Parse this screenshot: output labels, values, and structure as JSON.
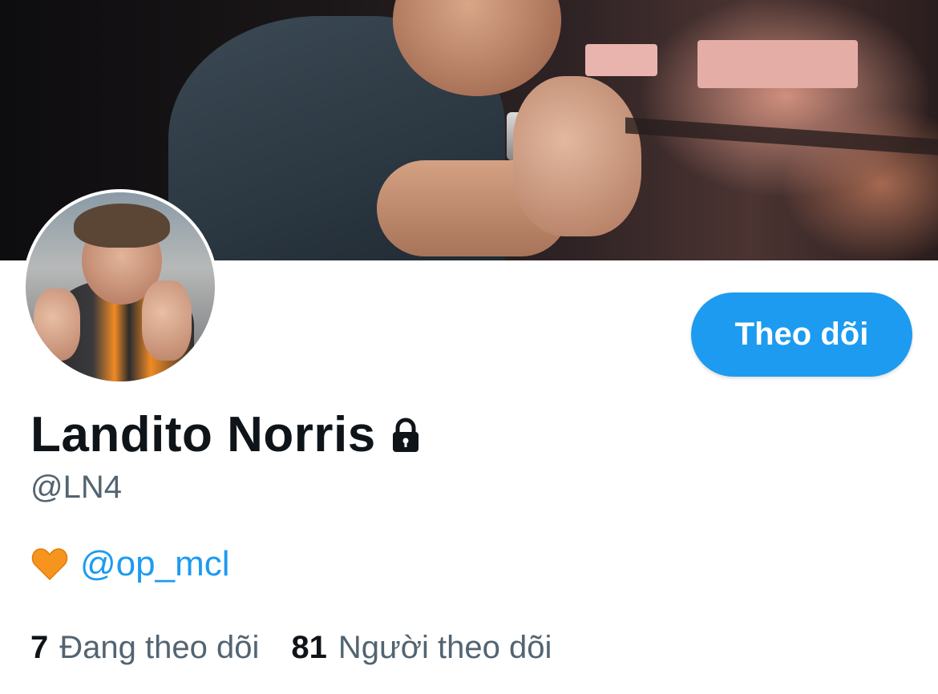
{
  "profile": {
    "display_name": "Landito Norris",
    "handle": "@LN4",
    "bio_mention": "@op_mcl",
    "follow_button": "Theo dõi"
  },
  "icons": {
    "lock": "lock-icon",
    "heart": "orange-heart-icon"
  },
  "stats": {
    "following_count": "7",
    "following_label": "Đang theo dõi",
    "followers_count": "81",
    "followers_label": "Người theo dõi"
  },
  "colors": {
    "accent": "#1d9bf0",
    "heart": "#f7941d",
    "text_primary": "#0f1419",
    "text_secondary": "#536471"
  }
}
